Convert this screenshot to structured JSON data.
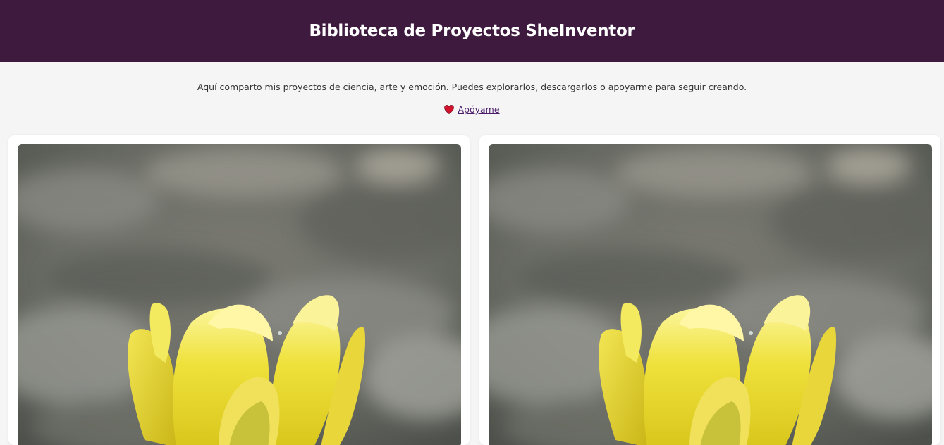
{
  "header": {
    "title": "Biblioteca de Proyectos SheInventor",
    "background_color": "#3d1a3e"
  },
  "intro": {
    "text": "Aquí comparto mis proyectos de ciencia, arte y emoción. Puedes explorarlos, descargarlos o apoyarme para seguir creando."
  },
  "support": {
    "icon": "heart-icon",
    "label": "Apóyame",
    "link_color": "#4b1d6b"
  },
  "cards": [
    {
      "image_subject": "yellow-flower-photo"
    },
    {
      "image_subject": "yellow-flower-photo"
    }
  ]
}
